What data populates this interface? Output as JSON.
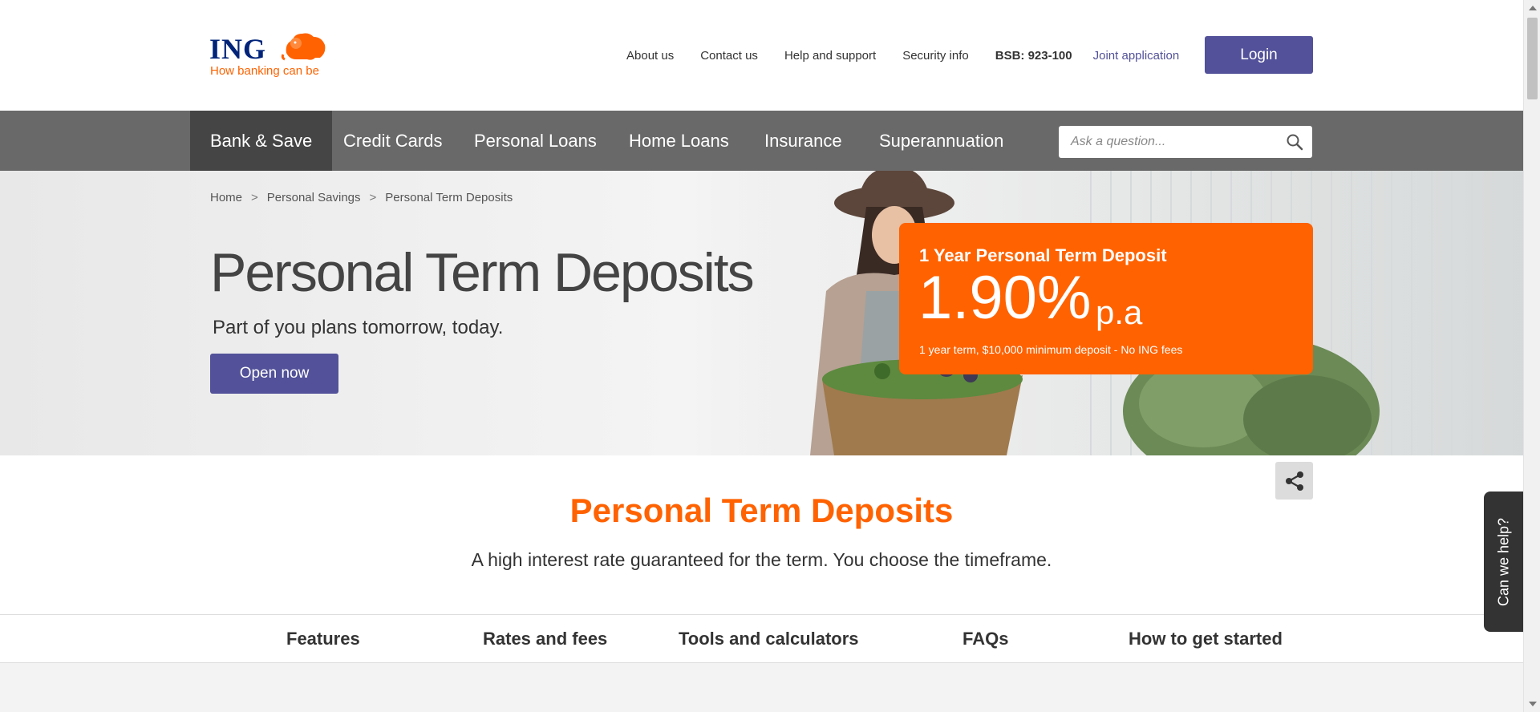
{
  "header": {
    "logo_text": "ING",
    "logo_tagline": "How banking can be",
    "top_links": [
      "About us",
      "Contact us",
      "Help and support",
      "Security info"
    ],
    "bsb": "BSB: 923-100",
    "joint_application": "Joint application",
    "login_label": "Login"
  },
  "nav": {
    "items": [
      "Bank & Save",
      "Credit Cards",
      "Personal Loans",
      "Home Loans",
      "Insurance",
      "Superannuation"
    ],
    "active": "Bank & Save",
    "search_placeholder": "Ask a question..."
  },
  "hero": {
    "breadcrumb": [
      "Home",
      "Personal Savings",
      "Personal Term Deposits"
    ],
    "breadcrumb_sep": ">",
    "title": "Personal Term Deposits",
    "subtitle": "Part of you plans tomorrow, today.",
    "cta_label": "Open now",
    "rate_card": {
      "title": "1 Year Personal Term Deposit",
      "rate": "1.90%",
      "suffix": "p.a",
      "note": "1 year term, $10,000 minimum deposit - No ING fees"
    }
  },
  "content": {
    "title": "Personal Term Deposits",
    "subtitle": "A high interest rate guaranteed for the term. You choose the timeframe."
  },
  "tabs": [
    "Features",
    "Rates and fees",
    "Tools and calculators",
    "FAQs",
    "How to get started"
  ],
  "help_tab": "Can we help?",
  "colors": {
    "brand_orange": "#ff6200",
    "brand_purple": "#525199",
    "nav_gray": "#696969",
    "nav_active": "#454545"
  }
}
